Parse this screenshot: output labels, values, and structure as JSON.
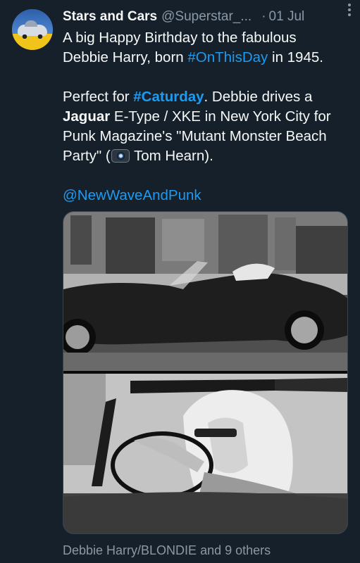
{
  "tweet": {
    "display_name": "Stars and Cars",
    "handle": "@Superstar_...",
    "separator": "·",
    "date": "01 Jul",
    "line1": "A big Happy Birthday to the fabulous",
    "line2_pre": "Debbie Harry, born ",
    "line2_hashtag": "#OnThisDay",
    "line2_post": " in 1945.",
    "line3_pre": "Perfect for ",
    "line3_hashtag": "#Caturday",
    "line3_post": ". Debbie drives a",
    "line4_bold": "Jaguar",
    "line4_post": " E-Type / XKE in New York City for",
    "line5": "Punk Magazine's \"Mutant Monster Beach",
    "line6_pre": "Party\" (",
    "line6_post": " Tom Hearn).",
    "mention": "@NewWaveAndPunk"
  },
  "footer": {
    "tagged": "Debbie Harry/BLONDIE and 9 others"
  },
  "icons": {
    "avatar": "vintage-car-avatar",
    "more": "more-vertical-icon",
    "camera": "camera-emoji-icon"
  },
  "colors": {
    "background": "#15202b",
    "text": "#f7f9f9",
    "secondary": "#8b98a5",
    "accent": "#1d9bf0"
  }
}
